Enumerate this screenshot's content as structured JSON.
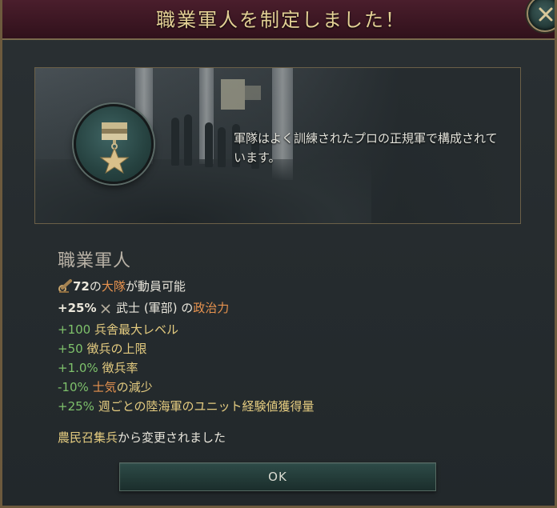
{
  "dialog": {
    "title": "職業軍人を制定しました！",
    "close_icon": "close-x-icon"
  },
  "banner": {
    "medal_icon": "military-star-medal-icon",
    "description": "軍隊はよく訓練されたプロの正規軍で構成されています。"
  },
  "details": {
    "heading": "職業軍人",
    "battalions": {
      "icon": "cannon-icon",
      "count": "72",
      "mid": "の",
      "highlight": "大隊",
      "rest": "が動員可能"
    },
    "lines": [
      {
        "value": "+25%",
        "icon": "crossed-swords-icon",
        "text": "武士 (軍部) の",
        "highlight": "政治力"
      },
      {
        "value": "+100",
        "text": "兵舎最大レベル"
      },
      {
        "value": "+50",
        "text": "徴兵の上限"
      },
      {
        "value": "+1.0%",
        "text": "徴兵率"
      },
      {
        "value": "-10%",
        "highlight": "士気",
        "text": "の減少"
      },
      {
        "value": "+25%",
        "text": "週ごとの陸海軍のユニット経験値獲得量"
      }
    ]
  },
  "changed": {
    "from": "農民召集兵",
    "text": "から変更されました"
  },
  "ok_button": {
    "label": "OK"
  },
  "colors": {
    "positive": "#7ec16b",
    "highlight": "#e8934f",
    "gold": "#e5cc80",
    "title_bg": "#3b1622"
  }
}
